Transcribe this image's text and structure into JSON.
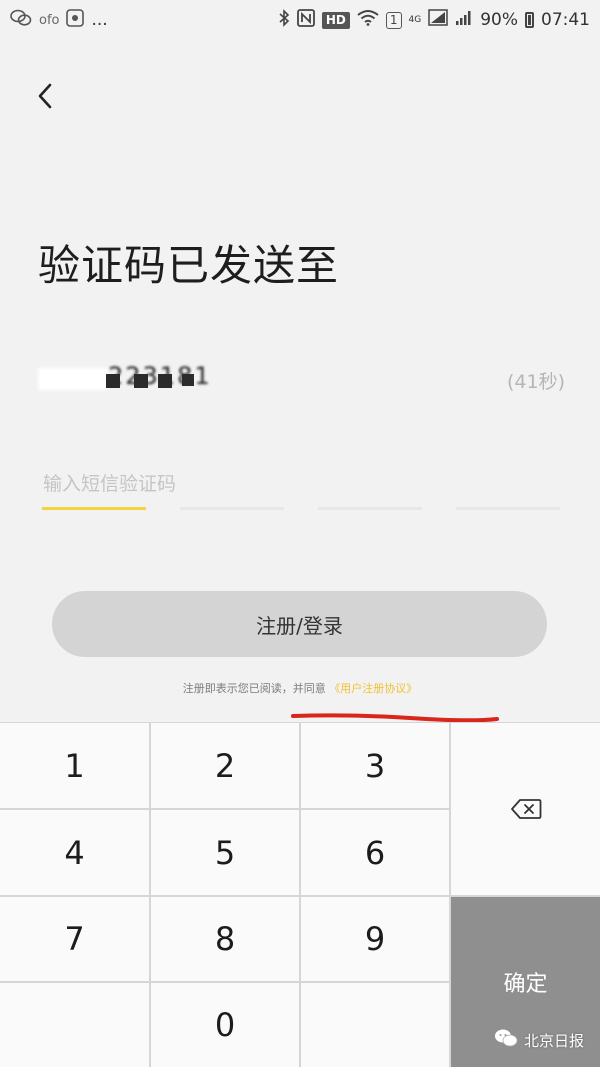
{
  "status_bar": {
    "left_text": "ofo",
    "ellipsis": "...",
    "hd": "HD",
    "network": "4G",
    "sim": "1",
    "battery": "90%",
    "time": "07:41"
  },
  "page": {
    "title": "验证码已发送至",
    "phone_visible": "      223181",
    "countdown": "(41秒)",
    "code_placeholder": "输入短信验证码",
    "submit_label": "注册/登录",
    "agreement_text": "注册即表示您已阅读，并同意",
    "agreement_link": "《用户注册协议》"
  },
  "keypad": {
    "k1": "1",
    "k2": "2",
    "k3": "3",
    "k4": "4",
    "k5": "5",
    "k6": "6",
    "k7": "7",
    "k8": "8",
    "k9": "9",
    "k0": "0",
    "confirm": "确定"
  },
  "watermark": {
    "text": "北京日报"
  },
  "colors": {
    "accent_yellow": "#f5d33d",
    "annotation_red": "#d8261c",
    "confirm_gray": "#8f8f8f",
    "button_gray": "#d4d4d4"
  },
  "icons": {
    "back": "chevron-left-icon",
    "backspace": "backspace-icon",
    "watermark": "wechat-icon"
  }
}
